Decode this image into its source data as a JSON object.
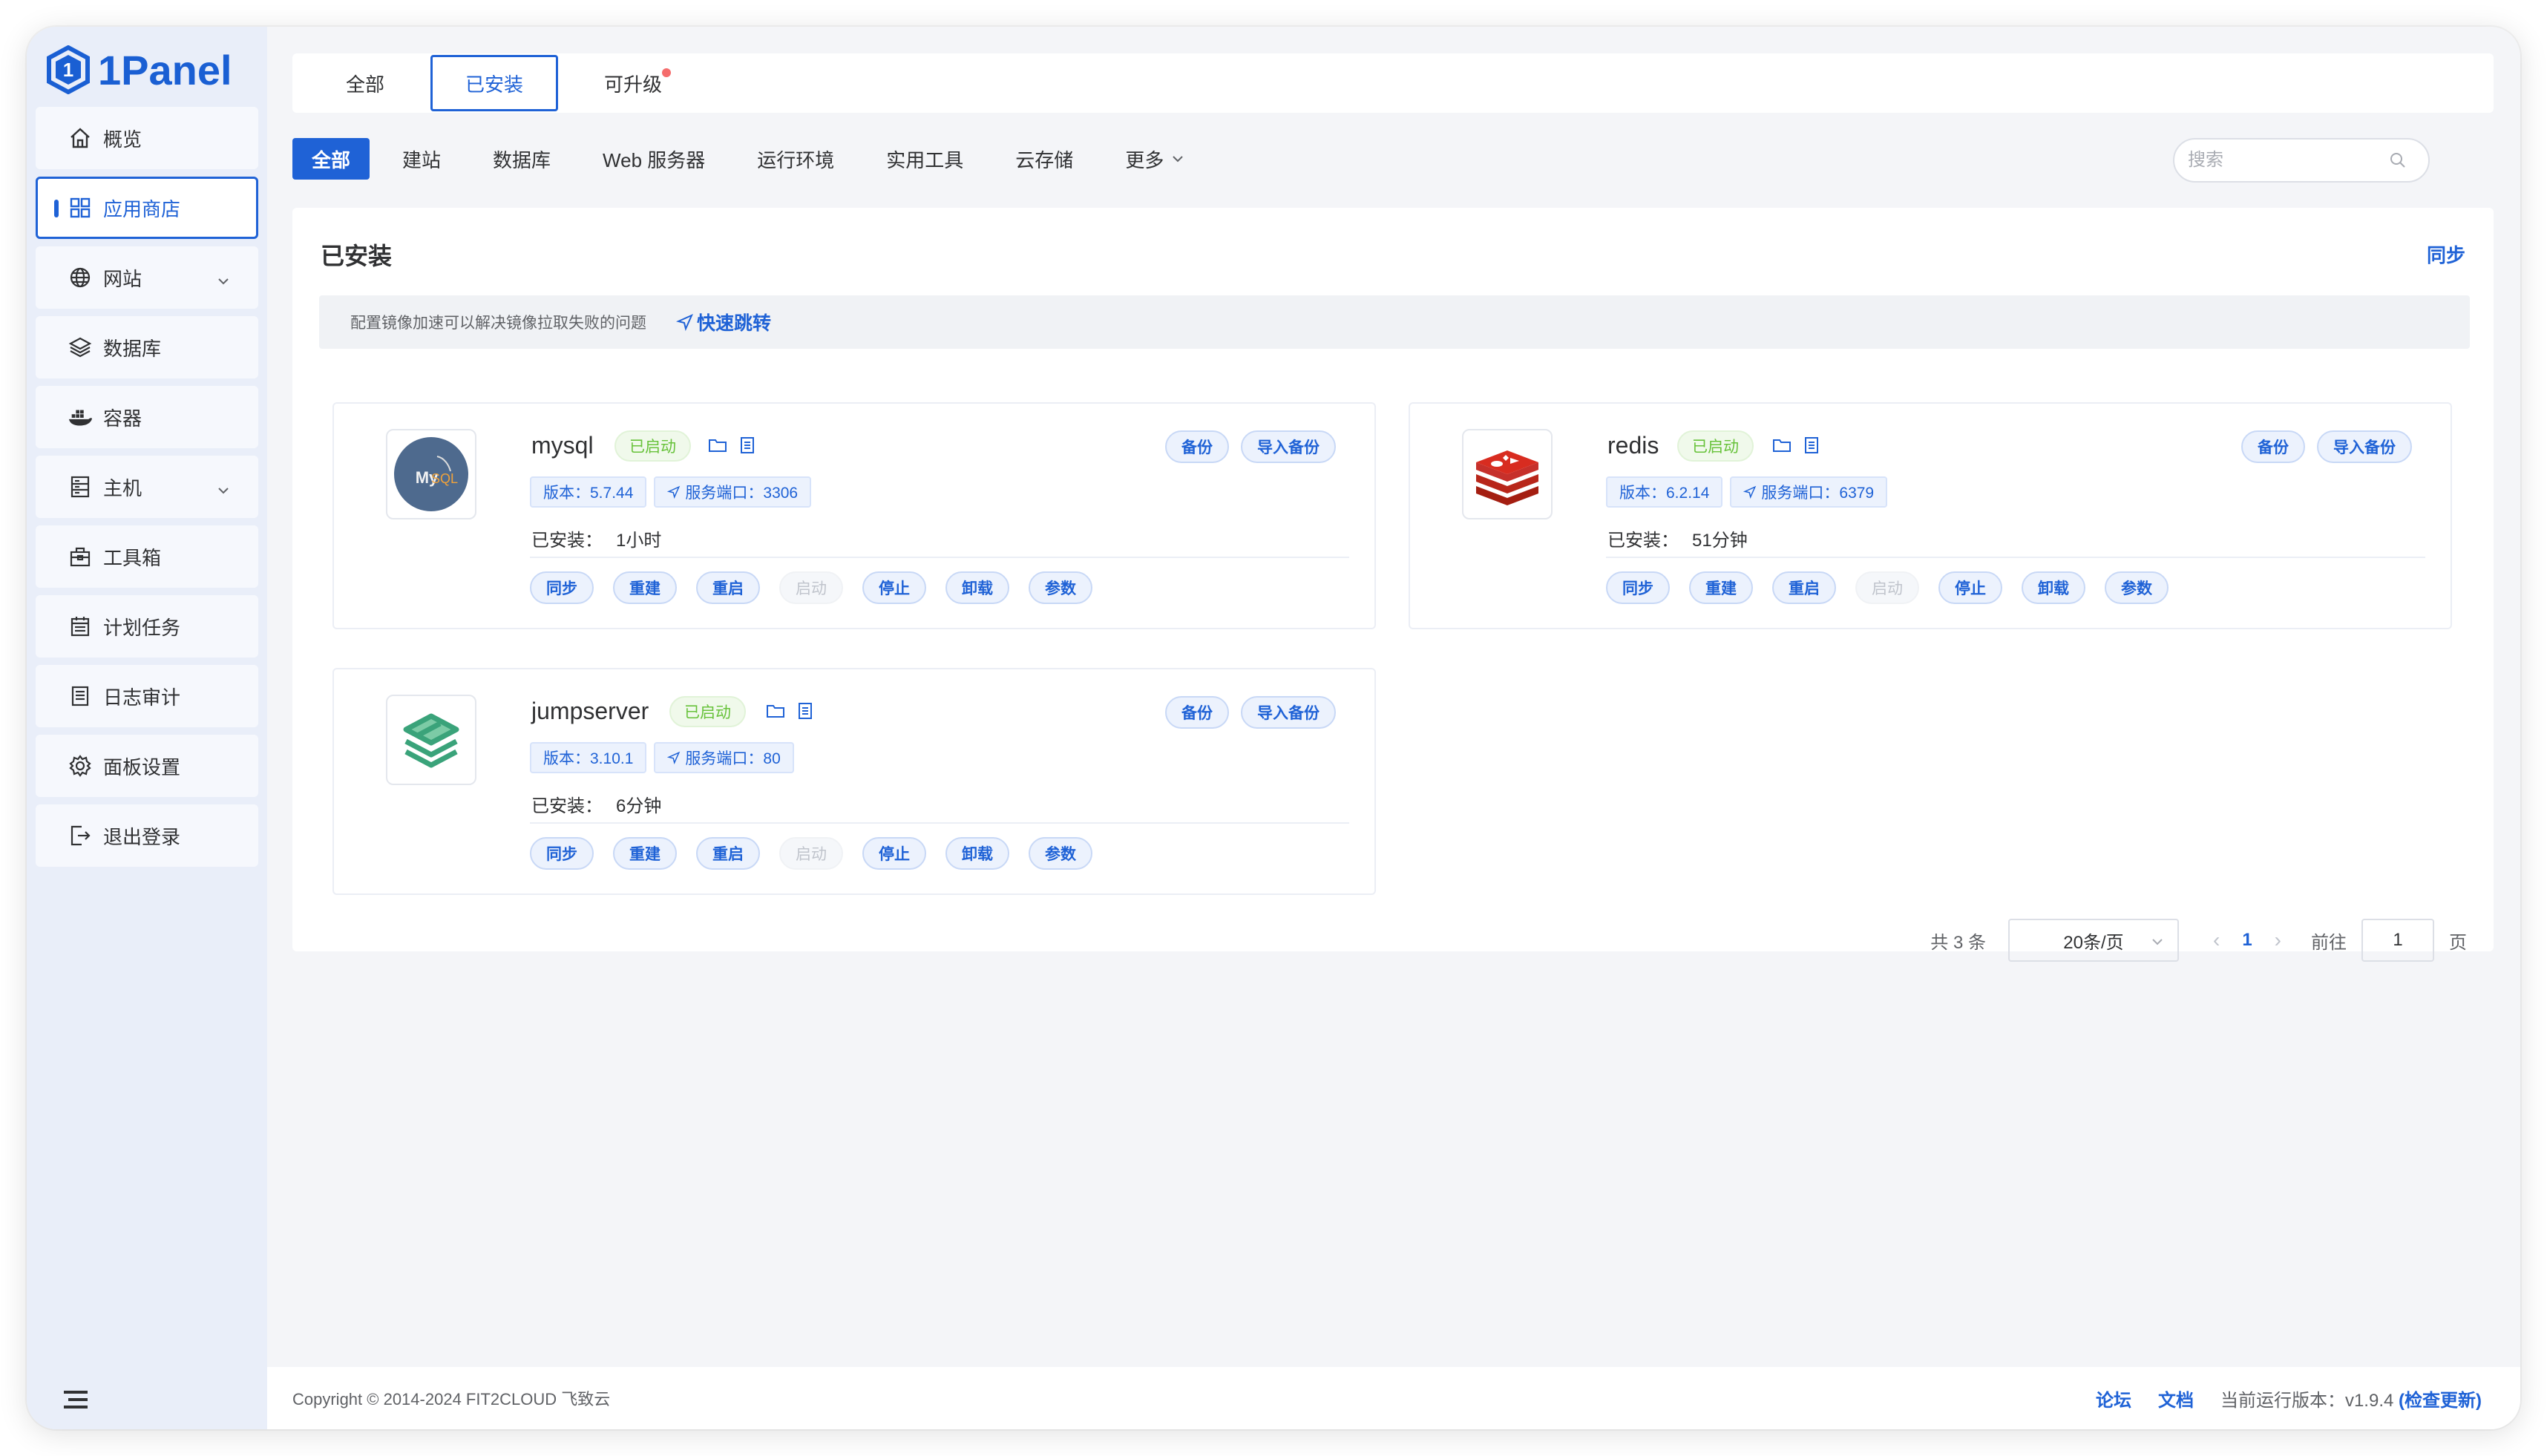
{
  "brand": {
    "name": "1Panel",
    "color": "#1f62d6"
  },
  "sidebar": {
    "items": [
      {
        "label": "概览",
        "icon": "home-icon"
      },
      {
        "label": "应用商店",
        "icon": "apps-grid-icon",
        "active": true
      },
      {
        "label": "网站",
        "icon": "globe-icon",
        "has_submenu": true
      },
      {
        "label": "数据库",
        "icon": "layers-icon"
      },
      {
        "label": "容器",
        "icon": "docker-icon"
      },
      {
        "label": "主机",
        "icon": "server-icon",
        "has_submenu": true
      },
      {
        "label": "工具箱",
        "icon": "toolbox-icon"
      },
      {
        "label": "计划任务",
        "icon": "calendar-icon"
      },
      {
        "label": "日志审计",
        "icon": "log-icon"
      },
      {
        "label": "面板设置",
        "icon": "gear-icon"
      },
      {
        "label": "退出登录",
        "icon": "logout-icon"
      }
    ]
  },
  "top_tabs": [
    {
      "label": "全部"
    },
    {
      "label": "已安装",
      "active": true
    },
    {
      "label": "可升级",
      "badge_dot": true
    }
  ],
  "categories": [
    {
      "label": "全部",
      "active": true
    },
    {
      "label": "建站"
    },
    {
      "label": "数据库"
    },
    {
      "label": "Web 服务器"
    },
    {
      "label": "运行环境"
    },
    {
      "label": "实用工具"
    },
    {
      "label": "云存储"
    },
    {
      "label": "更多"
    }
  ],
  "search": {
    "placeholder": "搜索",
    "value": ""
  },
  "panel": {
    "title": "已安装",
    "sync_label": "同步",
    "notice": "配置镜像加速可以解决镜像拉取失败的问题",
    "quick_jump": "快速跳转"
  },
  "labels": {
    "status": "已启动",
    "installed_prefix": "已安装：",
    "backup": "备份",
    "import_backup": "导入备份",
    "actions": [
      "同步",
      "重建",
      "重启",
      "启动",
      "停止",
      "卸载",
      "参数"
    ],
    "disabled_action": "启动"
  },
  "apps": [
    {
      "name": "mysql",
      "version": "版本：5.7.44",
      "port": "服务端口：3306",
      "installed": "1小时",
      "icon": "mysql-logo-icon"
    },
    {
      "name": "redis",
      "version": "版本：6.2.14",
      "port": "服务端口：6379",
      "installed": "51分钟",
      "icon": "redis-logo-icon"
    },
    {
      "name": "jumpserver",
      "version": "版本：3.10.1",
      "port": "服务端口：80",
      "installed": "6分钟",
      "icon": "jumpserver-logo-icon"
    }
  ],
  "pagination": {
    "total": "共 3 条",
    "page_size": "20条/页",
    "current_page": "1",
    "goto_label": "前往",
    "goto_value": "1",
    "page_suffix": "页"
  },
  "footer": {
    "copyright": "Copyright © 2014-2024 FIT2CLOUD 飞致云",
    "forum": "论坛",
    "docs": "文档",
    "version_label": "当前运行版本：",
    "version": "v1.9.4",
    "check_update": "(检查更新)"
  }
}
